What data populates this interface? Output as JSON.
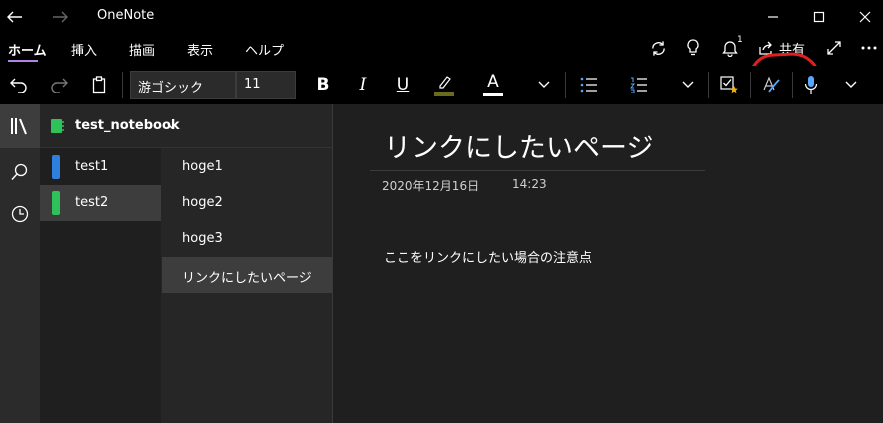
{
  "titlebar": {
    "app_title": "OneNote",
    "icons": [
      "back-icon",
      "forward-icon",
      "minimize-icon",
      "maximize-icon",
      "close-icon"
    ]
  },
  "ribbon": {
    "tabs": [
      {
        "label": "ホーム",
        "active": true
      },
      {
        "label": "挿入",
        "active": false
      },
      {
        "label": "描画",
        "active": false
      },
      {
        "label": "表示",
        "active": false
      },
      {
        "label": "ヘルプ",
        "active": false
      }
    ],
    "accent_color": "#b084e0",
    "notification_count": "1",
    "share_label": "共有",
    "annotation_color": "#e02020"
  },
  "toolbar": {
    "font_name": "游ゴシック",
    "font_size": "11",
    "bold": "B",
    "italic": "I",
    "underline": "U",
    "font_color": "A",
    "highlight_color": "#6b6b1e",
    "font_color_bar": "#ffffff"
  },
  "notebook": {
    "name": "test_notebook"
  },
  "sections": [
    {
      "label": "test1",
      "color": "#2f7fdc",
      "selected": false
    },
    {
      "label": "test2",
      "color": "#2fc25b",
      "selected": true
    }
  ],
  "pages": [
    {
      "label": "hoge1",
      "selected": false
    },
    {
      "label": "hoge2",
      "selected": false
    },
    {
      "label": "hoge3",
      "selected": false
    },
    {
      "label": "リンクにしたいページ",
      "selected": true
    }
  ],
  "page": {
    "title": "リンクにしたいページ",
    "date": "2020年12月16日",
    "time": "14:23",
    "body": "ここをリンクにしたい場合の注意点"
  }
}
